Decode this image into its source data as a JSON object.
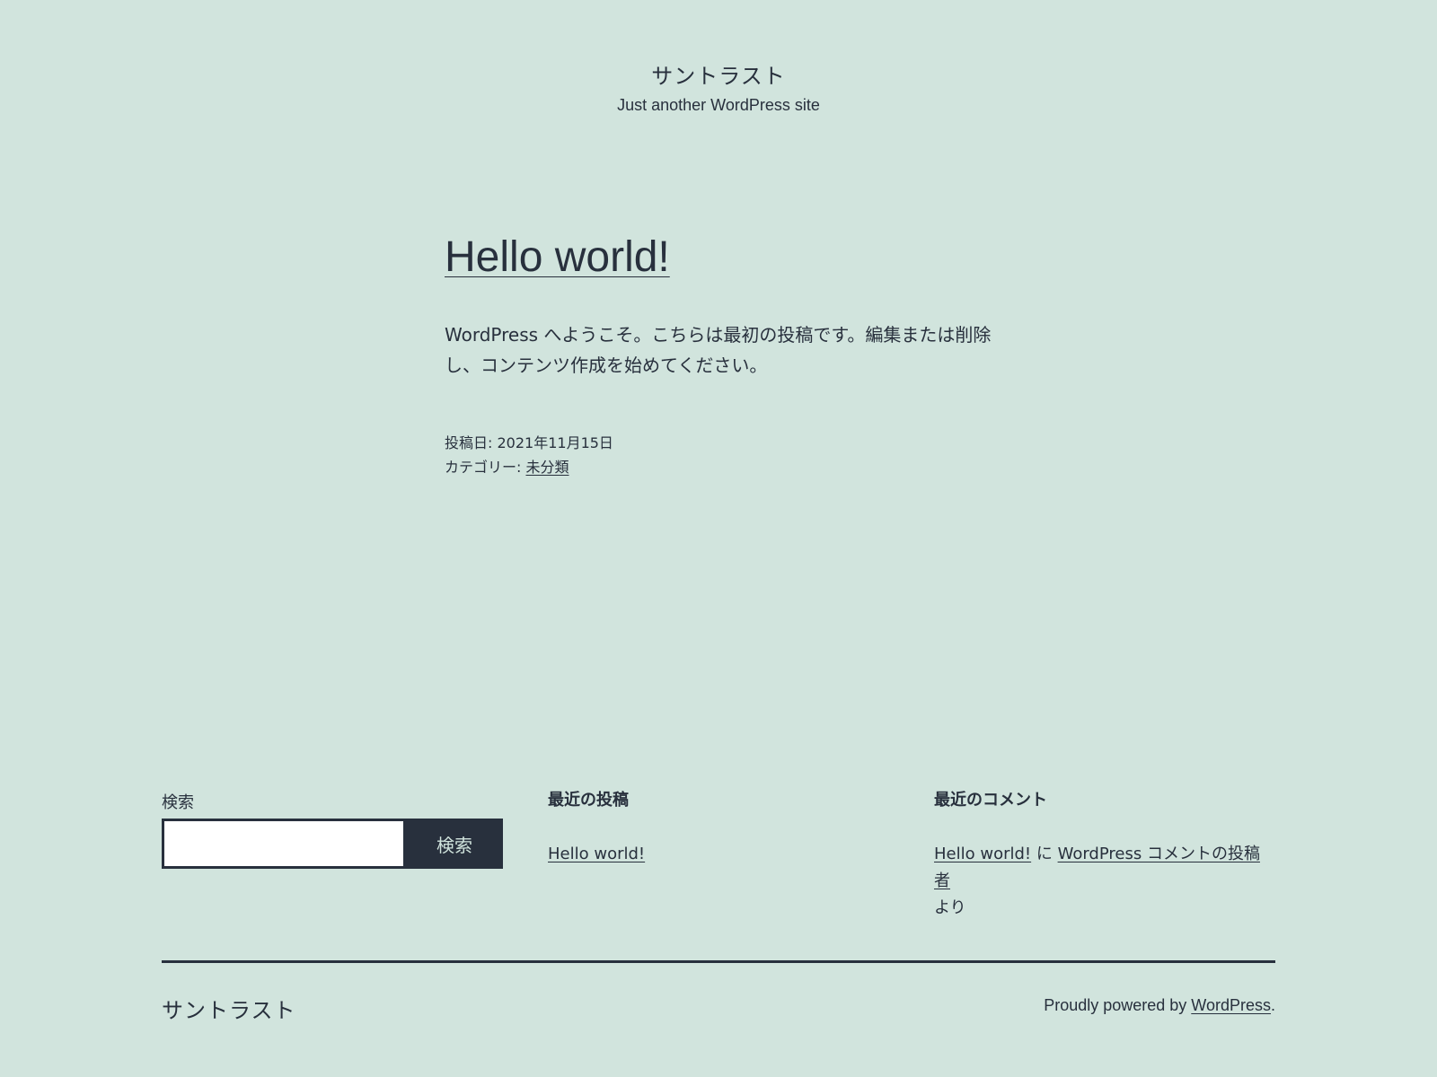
{
  "header": {
    "site_title": "サントラスト",
    "site_description": "Just another WordPress site"
  },
  "post": {
    "title": "Hello world!",
    "content": "WordPress へようこそ。こちらは最初の投稿です。編集または削除し、コンテンツ作成を始めてください。",
    "posted_on_label": "投稿日: ",
    "posted_on_date": "2021年11月15日",
    "category_label": "カテゴリー: ",
    "category_name": "未分類"
  },
  "widgets": {
    "search": {
      "label": "検索",
      "input_value": "",
      "button_label": "検索"
    },
    "recent_posts": {
      "title": "最近の投稿",
      "items": [
        "Hello world!"
      ]
    },
    "recent_comments": {
      "title": "最近のコメント",
      "post_link": "Hello world!",
      "connector": " に ",
      "author_link": "WordPress コメントの投稿者",
      "suffix": "より"
    }
  },
  "footer": {
    "site_title": "サントラスト",
    "powered_prefix": "Proudly powered by ",
    "powered_link": "WordPress",
    "powered_suffix": "."
  },
  "colors": {
    "background": "#d1e4dd",
    "text": "#28303d"
  }
}
